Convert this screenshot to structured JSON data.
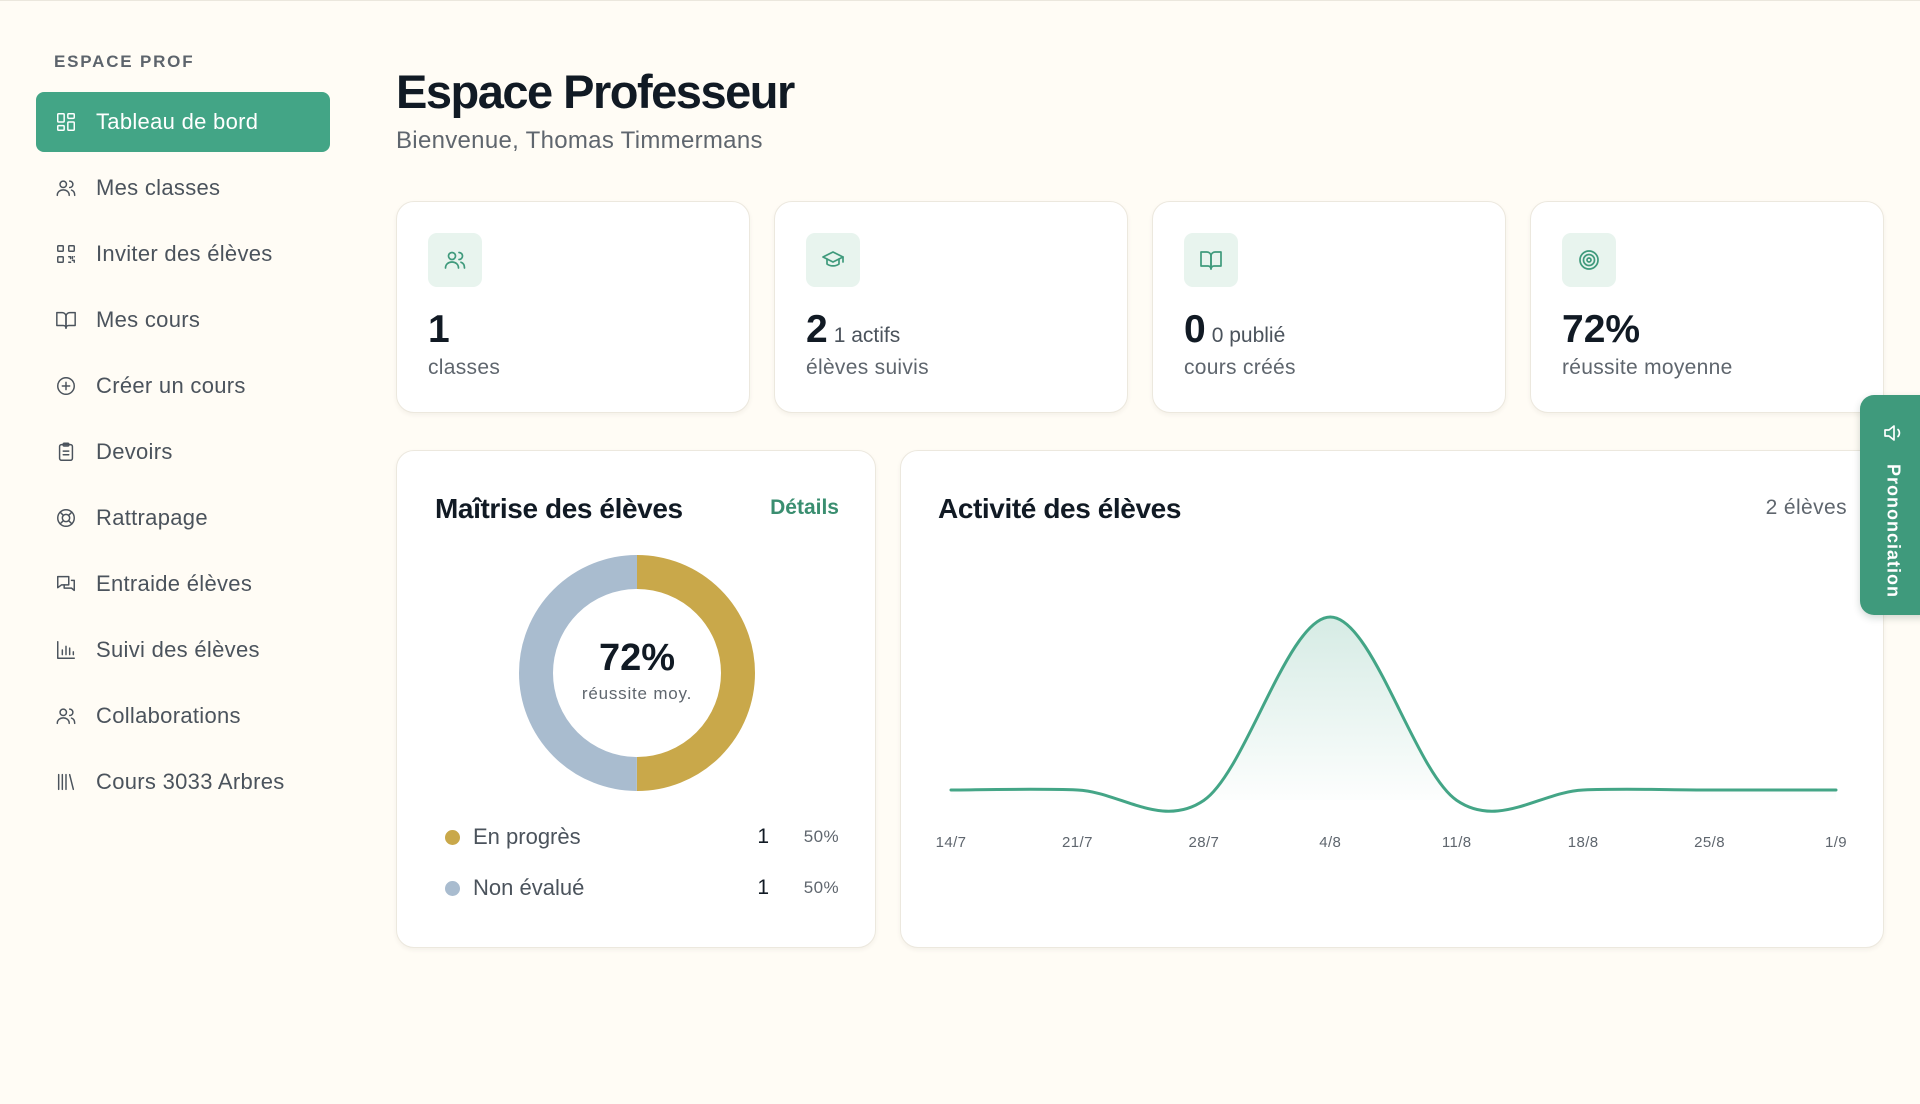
{
  "sidebar": {
    "title": "ESPACE PROF",
    "items": [
      {
        "label": "Tableau de bord",
        "icon": "dashboard-icon",
        "active": true
      },
      {
        "label": "Mes classes",
        "icon": "users-icon"
      },
      {
        "label": "Inviter des élèves",
        "icon": "qr-code-icon"
      },
      {
        "label": "Mes cours",
        "icon": "book-icon"
      },
      {
        "label": "Créer un cours",
        "icon": "plus-circle-icon"
      },
      {
        "label": "Devoirs",
        "icon": "clipboard-icon"
      },
      {
        "label": "Rattrapage",
        "icon": "lifebuoy-icon"
      },
      {
        "label": "Entraide élèves",
        "icon": "chat-icon"
      },
      {
        "label": "Suivi des élèves",
        "icon": "bar-chart-icon"
      },
      {
        "label": "Collaborations",
        "icon": "collaborators-icon"
      },
      {
        "label": "Cours 3033 Arbres",
        "icon": "library-icon"
      }
    ]
  },
  "header": {
    "title": "Espace Professeur",
    "subtitle": "Bienvenue, Thomas Timmermans"
  },
  "stats": [
    {
      "value": "1",
      "extra": "",
      "label": "classes",
      "icon": "users-icon"
    },
    {
      "value": "2",
      "extra": "1 actifs",
      "label": "élèves suivis",
      "icon": "graduation-cap-icon"
    },
    {
      "value": "0",
      "extra": "0 publié",
      "label": "cours créés",
      "icon": "book-icon"
    },
    {
      "value": "72%",
      "extra": "",
      "label": "réussite moyenne",
      "icon": "target-icon"
    }
  ],
  "mastery": {
    "title": "Maîtrise des élèves",
    "details_label": "Détails",
    "center_value": "72%",
    "center_label": "réussite moy.",
    "segments": [
      {
        "label": "En progrès",
        "count": "1",
        "percent": "50%",
        "value": 50,
        "color": "#c9a84a"
      },
      {
        "label": "Non évalué",
        "count": "1",
        "percent": "50%",
        "value": 50,
        "color": "#a9bccf"
      }
    ]
  },
  "activity": {
    "title": "Activité des élèves",
    "count_label": "2 élèves",
    "line_color": "#43a586"
  },
  "chart_data": {
    "type": "area",
    "title": "Activité des élèves",
    "x": [
      "14/7",
      "21/7",
      "28/7",
      "4/8",
      "11/8",
      "18/8",
      "25/8",
      "1/9"
    ],
    "tick_labels": [
      "14/7",
      "21/7",
      "28/7",
      "4/8",
      "11/8",
      "18/8",
      "25/8",
      "1/9"
    ],
    "series": [
      {
        "values": [
          0,
          0,
          -0.06,
          1,
          -0.06,
          0,
          0,
          0
        ]
      }
    ],
    "ylim": [
      -0.1,
      1.05
    ],
    "grid": false
  },
  "pronunciation": {
    "label": "Prononciation",
    "icon": "speaker-icon"
  }
}
